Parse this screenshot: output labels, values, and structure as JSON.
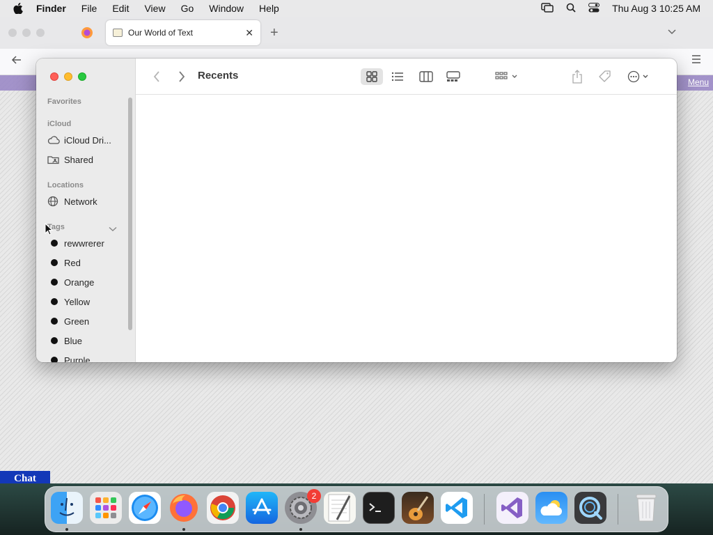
{
  "menubar": {
    "app_name": "Finder",
    "items": [
      "File",
      "Edit",
      "View",
      "Go",
      "Window",
      "Help"
    ],
    "datetime": "Thu Aug 3  10:25 AM"
  },
  "browser": {
    "tab_title": "Our World of Text",
    "page_menu_label": "Menu",
    "chat_label": "Chat"
  },
  "finder": {
    "title": "Recents",
    "sidebar": {
      "favorites_header": "Favorites",
      "icloud_header": "iCloud",
      "icloud_items": [
        {
          "label": "iCloud Dri...",
          "icon": "cloud-icon"
        },
        {
          "label": "Shared",
          "icon": "shared-folder-icon"
        }
      ],
      "locations_header": "Locations",
      "location_items": [
        {
          "label": "Network",
          "icon": "globe-icon"
        }
      ],
      "tags_header": "Tags",
      "tags": [
        "rewwrerer",
        "Red",
        "Orange",
        "Yellow",
        "Green",
        "Blue",
        "Purple"
      ]
    },
    "toolbar_icons": [
      "back-icon",
      "forward-icon",
      "icon-view-icon",
      "list-view-icon",
      "column-view-icon",
      "gallery-view-icon",
      "group-icon",
      "share-icon",
      "tag-icon",
      "more-icon",
      "search-icon"
    ]
  },
  "dock": {
    "apps": [
      "Finder",
      "Launchpad",
      "Safari",
      "Firefox",
      "Chrome",
      "App Store",
      "System Settings",
      "TextEdit",
      "Terminal",
      "GarageBand",
      "Visual Studio Code",
      "Visual Studio",
      "Weather",
      "QuickTime",
      "Trash"
    ],
    "system_settings_badge": "2"
  }
}
